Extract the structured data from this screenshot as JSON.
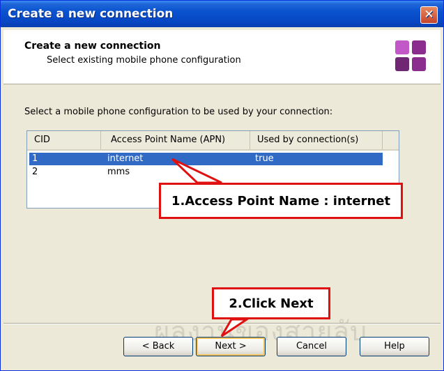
{
  "window": {
    "title": "Create a new connection",
    "close_glyph": "✕"
  },
  "header": {
    "title": "Create a new connection",
    "subtitle": "Select existing mobile phone configuration",
    "logo_icon": "four-squares-logo-icon"
  },
  "instruction": "Select a mobile phone configuration to be used by your connection:",
  "list": {
    "columns": [
      "CID",
      "Access Point Name (APN)",
      "Used by connection(s)"
    ],
    "rows": [
      {
        "cid": "1",
        "apn": "internet",
        "used_by": "true",
        "selected": true
      },
      {
        "cid": "2",
        "apn": "mms",
        "used_by": "",
        "selected": false
      }
    ]
  },
  "buttons": {
    "back": "< Back",
    "next": "Next >",
    "cancel": "Cancel",
    "help": "Help"
  },
  "annotations": {
    "callout_1": "1.Access Point Name : internet",
    "callout_2": "2.Click Next"
  },
  "watermark": "ผลงานของสายลับ",
  "colors": {
    "title_bar": "#0846c2",
    "selection": "#316ac5",
    "callout_border": "#e01010"
  }
}
